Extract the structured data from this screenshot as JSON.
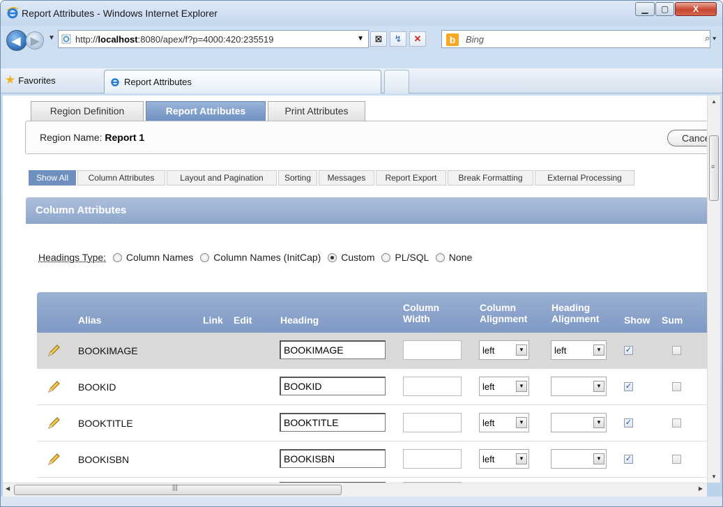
{
  "window": {
    "title": "Report Attributes - Windows Internet Explorer",
    "minimize": "▁",
    "maximize": "▢",
    "close": "X"
  },
  "addressbar": {
    "url_prefix": "http://",
    "url_host": "localhost",
    "url_rest": ":8080/apex/f?p=4000:420:235519",
    "search_placeholder": "Bing"
  },
  "favorites": {
    "label": "Favorites",
    "tab_title": "Report Attributes"
  },
  "page_tabs": [
    "Region Definition",
    "Report Attributes",
    "Print Attributes"
  ],
  "region": {
    "label": "Region Name:",
    "name": "Report 1",
    "cancel": "Cancel"
  },
  "sub_tabs": [
    "Show All",
    "Column Attributes",
    "Layout and Pagination",
    "Sorting",
    "Messages",
    "Report Export",
    "Break Formatting",
    "External Processing"
  ],
  "section": {
    "title": "Column Attributes"
  },
  "headings_type": {
    "label": "Headings Type:",
    "options": [
      "Column Names",
      "Column Names (InitCap)",
      "Custom",
      "PL/SQL",
      "None"
    ],
    "selected": "Custom"
  },
  "table": {
    "headers": {
      "alias": "Alias",
      "link": "Link",
      "edit": "Edit",
      "heading": "Heading",
      "col_width_1": "Column",
      "col_width_2": "Width",
      "col_align_1": "Column",
      "col_align_2": "Alignment",
      "head_align_1": "Heading",
      "head_align_2": "Alignment",
      "show": "Show",
      "sum": "Sum"
    },
    "rows": [
      {
        "alias": "BOOKIMAGE",
        "heading": "BOOKIMAGE",
        "column_alignment": "left",
        "heading_alignment": "left",
        "show": true,
        "sum": false
      },
      {
        "alias": "BOOKID",
        "heading": "BOOKID",
        "column_alignment": "left",
        "heading_alignment": "",
        "show": true,
        "sum": false
      },
      {
        "alias": "BOOKTITLE",
        "heading": "BOOKTITLE",
        "column_alignment": "left",
        "heading_alignment": "",
        "show": true,
        "sum": false
      },
      {
        "alias": "BOOKISBN",
        "heading": "BOOKISBN",
        "column_alignment": "left",
        "heading_alignment": "",
        "show": true,
        "sum": false
      }
    ]
  },
  "colors": {
    "accent": "#6f8fbf",
    "header_blue": "#8ea6cb",
    "selected_row": "#d9d9d9"
  }
}
